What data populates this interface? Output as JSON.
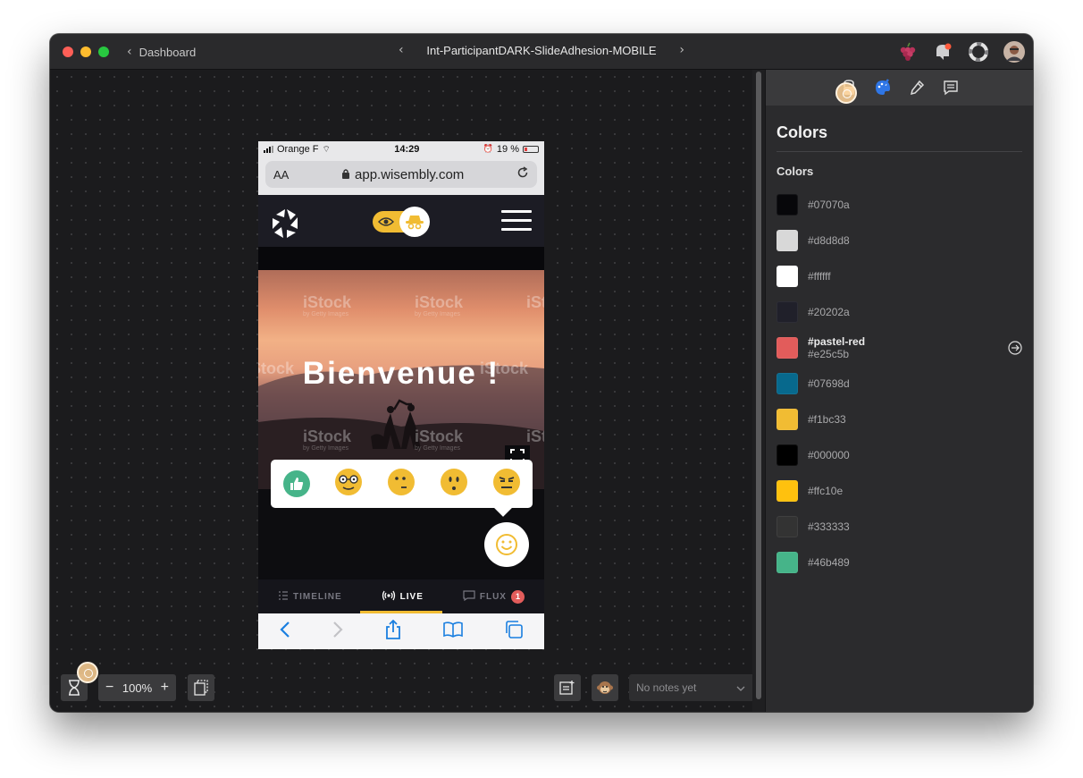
{
  "titlebar": {
    "back_label": "Dashboard",
    "document_title": "Int-ParticipantDARK-SlideAdhesion-MOBILE",
    "icons": [
      "grapes-icon",
      "notification-icon",
      "help-lifebuoy-icon",
      "user-avatar"
    ]
  },
  "sidebar": {
    "tools": [
      "inspect-icon",
      "palette-icon",
      "eyedropper-icon",
      "notes-icon"
    ],
    "title": "Colors",
    "section_label": "Colors",
    "colors": [
      {
        "hex": "#07070a",
        "label": "#07070a"
      },
      {
        "hex": "#d8d8d8",
        "label": "#d8d8d8"
      },
      {
        "hex": "#ffffff",
        "label": "#ffffff"
      },
      {
        "hex": "#20202a",
        "label": "#20202a"
      },
      {
        "hex": "#e25c5b",
        "name": "#pastel-red",
        "label": "#e25c5b"
      },
      {
        "hex": "#07698d",
        "label": "#07698d"
      },
      {
        "hex": "#f1bc33",
        "label": "#f1bc33"
      },
      {
        "hex": "#000000",
        "label": "#000000"
      },
      {
        "hex": "#ffc10e",
        "label": "#ffc10e"
      },
      {
        "hex": "#333333",
        "label": "#333333"
      },
      {
        "hex": "#46b489",
        "label": "#46b489"
      }
    ]
  },
  "bottombar": {
    "zoom": "100%",
    "zoom_out": "−",
    "zoom_in": "+",
    "notes_placeholder": "No notes yet"
  },
  "phone": {
    "carrier": "Orange F",
    "time": "14:29",
    "battery": "19 %",
    "text_size": "AA",
    "url": "app.wisembly.com",
    "hero_title": "Bienvenue !",
    "watermark": "iStock",
    "watermark_sub": "by Getty Images",
    "tabs": [
      {
        "label": "TIMELINE",
        "active": false
      },
      {
        "label": "LIVE",
        "active": true
      },
      {
        "label": "FLUX",
        "active": false,
        "badge": "1"
      }
    ]
  },
  "colors": {
    "accent_yellow": "#f1bc33",
    "badge_red": "#e25c5b",
    "green": "#46b489"
  }
}
